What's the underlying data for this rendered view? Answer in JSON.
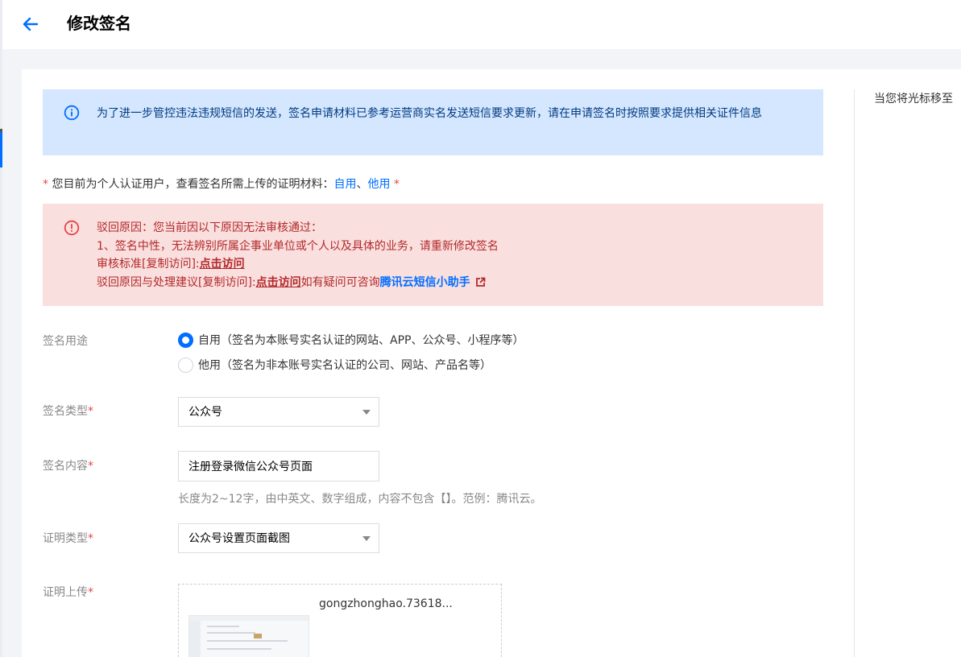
{
  "header": {
    "title": "修改签名"
  },
  "info_alert": {
    "text": "为了进一步管控违法违规短信的发送，签名申请材料已参考运营商实名发送短信要求更新，请在申请签名时按照要求提供相关证件信息"
  },
  "notice": {
    "required_mark": "*",
    "text": " 您目前为个人认证用户，查看签名所需上传的证明材料：",
    "link_self": "自用",
    "separator": "、",
    "link_other": "他用",
    "trailing_mark": " *"
  },
  "reject_alert": {
    "line1": "驳回原因：您当前因以下原因无法审核通过：",
    "line2": "1、签名中性，无法辨别所属企事业单位或个人以及具体的业务，请重新修改签名",
    "line3_prefix": "审核标准[复制访问]:",
    "line3_link": "点击访问",
    "line4_prefix": "驳回原因与处理建议[复制访问]:",
    "line4_link": "点击访问",
    "line4_middle": "如有疑问可咨询",
    "line4_helper": "腾讯云短信小助手"
  },
  "form": {
    "usage_label": "签名用途",
    "usage_options": [
      {
        "label": "自用（签名为本账号实名认证的网站、APP、公众号、小程序等）",
        "selected": true
      },
      {
        "label": "他用（签名为非本账号实名认证的公司、网站、产品名等）",
        "selected": false
      }
    ],
    "type_label": "签名类型",
    "type_value": "公众号",
    "content_label": "签名内容",
    "content_value": "注册登录微信公众号页面",
    "content_help": "长度为2~12字，由中英文、数字组成，内容不包含【】。范例：腾讯云。",
    "proof_type_label": "证明类型",
    "proof_type_value": "公众号设置页面截图",
    "proof_upload_label": "证明上传",
    "required_mark": "*",
    "upload_file_name": "gongzhonghao.73618..."
  },
  "side_panel": {
    "hint": "当您将光标移至"
  },
  "colors": {
    "accent": "#006eff",
    "info_bg": "#d5e7ff",
    "error_bg": "#fadfdf",
    "error_text": "#b32929",
    "required": "#e54545"
  }
}
